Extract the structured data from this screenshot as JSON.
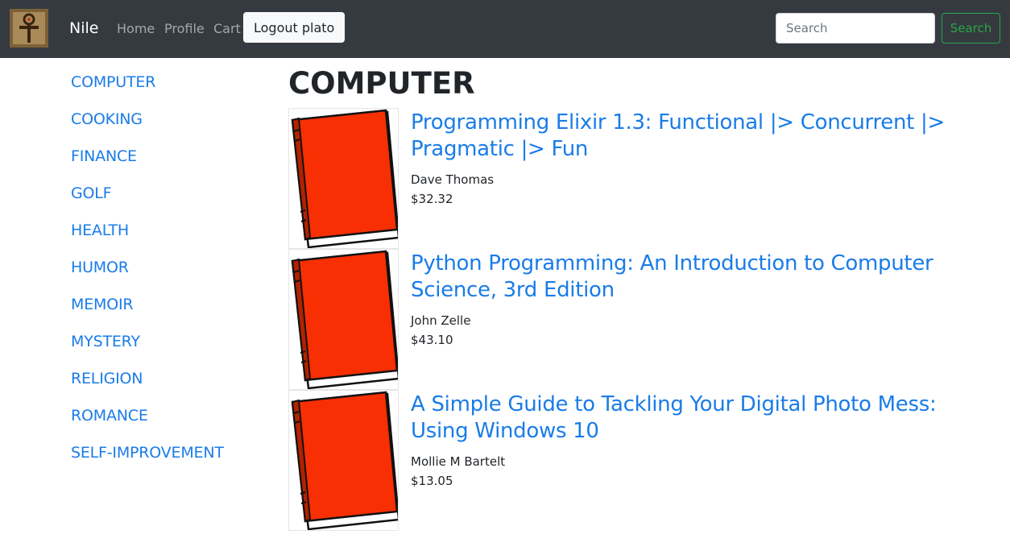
{
  "navbar": {
    "logo_icon": "ankh-figure-logo",
    "brand": "Nile",
    "links": [
      "Home",
      "Profile",
      "Cart"
    ],
    "logout_label": "Logout plato",
    "search_placeholder": "Search",
    "search_button": "Search"
  },
  "sidebar": {
    "categories": [
      "COMPUTER",
      "COOKING",
      "FINANCE",
      "GOLF",
      "HEALTH",
      "HUMOR",
      "MEMOIR",
      "MYSTERY",
      "RELIGION",
      "ROMANCE",
      "SELF-IMPROVEMENT"
    ]
  },
  "main": {
    "heading": "COMPUTER",
    "books": [
      {
        "title": "Programming Elixir 1.3: Functional |> Concurrent |> Pragmatic |> Fun",
        "author": "Dave Thomas",
        "price": "$32.32",
        "cover_icon": "red-book-icon"
      },
      {
        "title": "Python Programming: An Introduction to Computer Science, 3rd Edition",
        "author": "John Zelle",
        "price": "$43.10",
        "cover_icon": "red-book-icon"
      },
      {
        "title": "A Simple Guide to Tackling Your Digital Photo Mess: Using Windows 10",
        "author": "Mollie M Bartelt",
        "price": "$13.05",
        "cover_icon": "red-book-icon"
      }
    ]
  },
  "colors": {
    "navbar_bg": "#343a40",
    "link": "#1a7ce8",
    "search_button": "#28a745",
    "book_cover": "#f72f03"
  }
}
